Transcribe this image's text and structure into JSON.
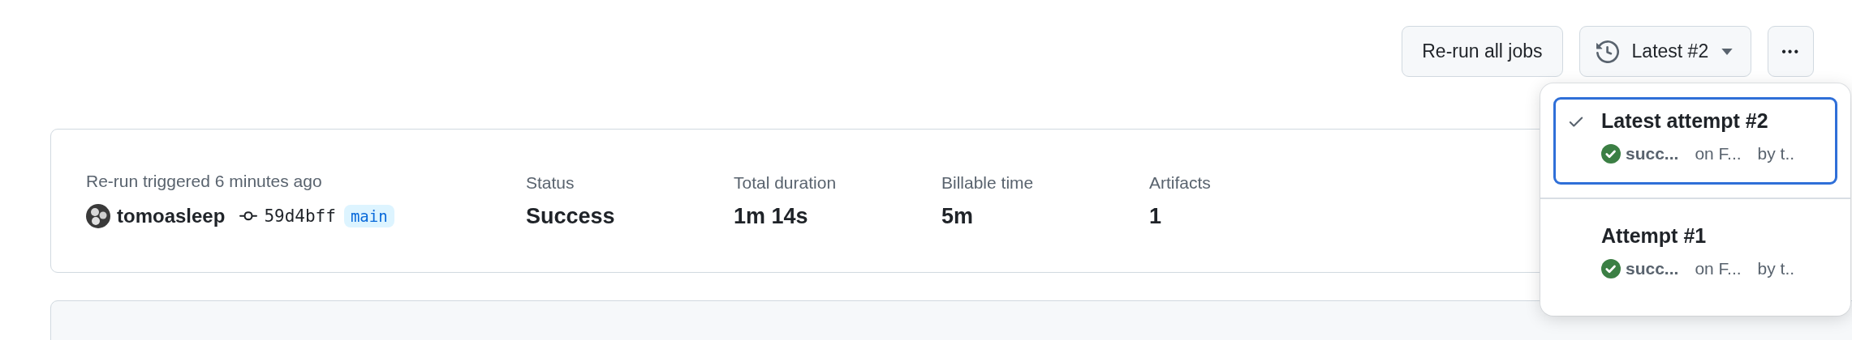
{
  "header_actions": {
    "rerun_button": "Re-run all jobs",
    "attempt_menu_button": "Latest #2",
    "more_button": "•••"
  },
  "summary": {
    "trigger": "Re-run triggered 6 minutes ago",
    "actor": "tomoasleep",
    "commit": "59d4bff",
    "branch": "main",
    "stats": [
      {
        "label": "Status",
        "value": "Success"
      },
      {
        "label": "Total duration",
        "value": "1m 14s"
      },
      {
        "label": "Billable time",
        "value": "5m"
      },
      {
        "label": "Artifacts",
        "value": "1"
      }
    ]
  },
  "attempts_menu": [
    {
      "title": "Latest attempt #2",
      "selected": true,
      "status": "succ...",
      "branch": "on F...",
      "actor": "by t.."
    },
    {
      "title": "Attempt #1",
      "selected": false,
      "status": "succ...",
      "branch": "on F...",
      "actor": "by t.."
    }
  ]
}
